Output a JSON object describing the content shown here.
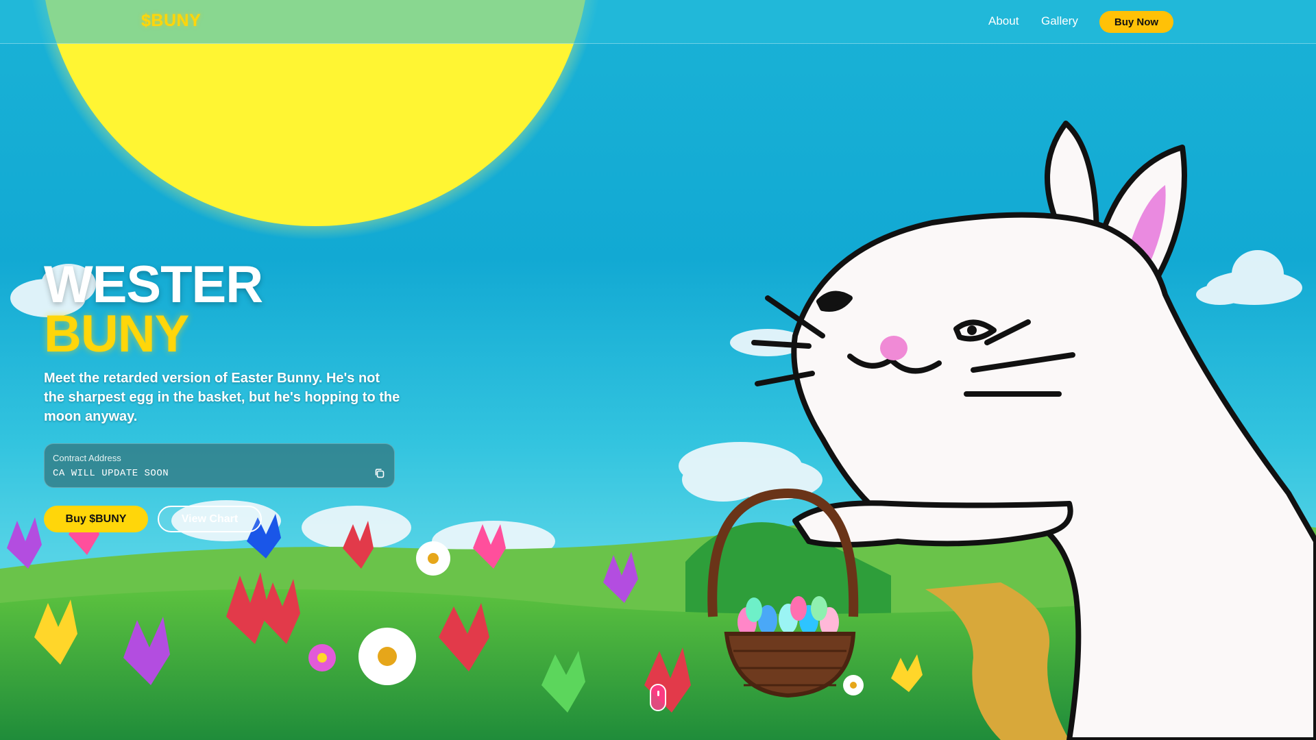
{
  "nav": {
    "logo": "$BUNY",
    "links": [
      "About",
      "Gallery"
    ],
    "cta": "Buy Now"
  },
  "hero": {
    "title_line1": "WESTER",
    "title_line2": "BUNY",
    "description": "Meet the retarded version of Easter Bunny. He's not the sharpest egg in the basket, but he's hopping to the moon anyway.",
    "contract": {
      "label": "Contract Address",
      "value": "CA WILL UPDATE SOON",
      "copy_icon": "copy-icon"
    },
    "buttons": {
      "primary": "Buy $BUNY",
      "secondary": "View Chart"
    }
  },
  "colors": {
    "sky": "#12a9d3",
    "sun": "#fff23a",
    "accent": "#ffd60a",
    "nav_button": "#ffc107",
    "grass": "#2fa23e"
  },
  "icons": [
    "copy-icon",
    "mouse-scroll-icon",
    "sun-illustration",
    "bunny-illustration",
    "basket-illustration"
  ]
}
